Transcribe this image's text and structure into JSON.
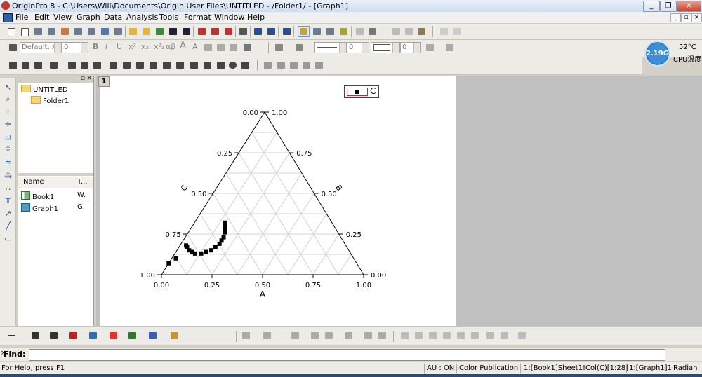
{
  "window": {
    "title": "OriginPro 8 - C:\\Users\\Will\\Documents\\Origin User Files\\UNTITLED - /Folder1/ - [Graph1]",
    "controls": [
      "_",
      "❐",
      "✕"
    ]
  },
  "menubar": {
    "items": [
      "File",
      "Edit",
      "View",
      "Graph",
      "Data",
      "Analysis",
      "Tools",
      "Format",
      "Window",
      "Help"
    ],
    "mdi_controls": [
      "_",
      "▫",
      "×"
    ]
  },
  "format_toolbar": {
    "font_name": "Default: A",
    "font_size": "0",
    "line_width": "0",
    "border_width": "0",
    "text_buttons": [
      "B",
      "I",
      "U",
      "x²",
      "x₂",
      "x²₁",
      "αβ",
      "A",
      "A"
    ]
  },
  "cpu_widget": {
    "frequency": "2.19G",
    "temperature": "52°C",
    "label": "CPU温度"
  },
  "explorer": {
    "tree": [
      "UNTITLED",
      "Folder1"
    ],
    "columns": [
      "Name",
      "T..."
    ],
    "items": [
      {
        "name": "Book1",
        "type": "W.",
        "icon": "workbook-icon"
      },
      {
        "name": "Graph1",
        "type": "G.",
        "icon": "graph-icon"
      }
    ]
  },
  "graph": {
    "layer_number": "1",
    "legend_label": "C",
    "axis_A_label": "A",
    "axis_B_label": "B",
    "axis_C_label": "C"
  },
  "chart_data": {
    "type": "scatter",
    "subtype": "ternary",
    "series": [
      {
        "name": "C",
        "color": "#000000",
        "symbol": "square",
        "points": [
          {
            "a": 0.03,
            "b": 0.18,
            "c": 0.79
          },
          {
            "a": 0.04,
            "b": 0.17,
            "c": 0.79
          },
          {
            "a": 0.06,
            "b": 0.15,
            "c": 0.79
          },
          {
            "a": 0.08,
            "b": 0.14,
            "c": 0.78
          },
          {
            "a": 0.1,
            "b": 0.13,
            "c": 0.77
          },
          {
            "a": 0.13,
            "b": 0.13,
            "c": 0.74
          },
          {
            "a": 0.15,
            "b": 0.14,
            "c": 0.71
          },
          {
            "a": 0.17,
            "b": 0.15,
            "c": 0.68
          },
          {
            "a": 0.18,
            "b": 0.17,
            "c": 0.65
          },
          {
            "a": 0.19,
            "b": 0.19,
            "c": 0.62
          },
          {
            "a": 0.19,
            "b": 0.21,
            "c": 0.6
          },
          {
            "a": 0.19,
            "b": 0.23,
            "c": 0.58
          },
          {
            "a": 0.18,
            "b": 0.26,
            "c": 0.56
          },
          {
            "a": 0.17,
            "b": 0.28,
            "c": 0.55
          },
          {
            "a": 0.16,
            "b": 0.3,
            "c": 0.54
          },
          {
            "a": 0.15,
            "b": 0.32,
            "c": 0.53
          },
          {
            "a": 0.02,
            "b": 0.1,
            "c": 0.88
          },
          {
            "a": 0.0,
            "b": 0.07,
            "c": 0.93
          }
        ]
      }
    ],
    "axes": {
      "A": {
        "label": "A",
        "range": [
          0,
          1
        ],
        "ticks": [
          "0.00",
          "0.25",
          "0.50",
          "0.75",
          "1.00"
        ]
      },
      "B": {
        "label": "B",
        "range": [
          0,
          1
        ],
        "ticks": [
          "0.00",
          "0.25",
          "0.50",
          "0.75",
          "1.00"
        ]
      },
      "C": {
        "label": "C",
        "range": [
          0,
          1
        ],
        "ticks": [
          "0.00",
          "0.25",
          "0.50",
          "0.75",
          "1.00"
        ]
      }
    },
    "grid": true,
    "legend": "top-right"
  },
  "findbar": {
    "label": "Find:",
    "value": ""
  },
  "statusbar": {
    "help": "For Help, press F1",
    "au": "AU : ON",
    "theme": "Color Publication",
    "cell": "1:[Book1]Sheet1!Col(C)[1:28]",
    "layer": "1:[Graph1]1",
    "angle": "Radian"
  }
}
